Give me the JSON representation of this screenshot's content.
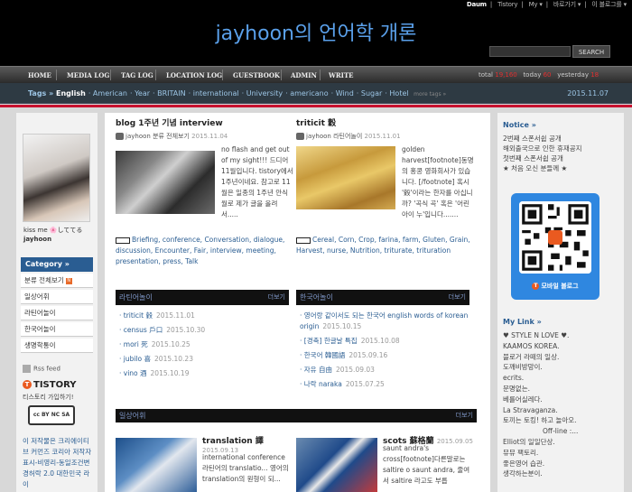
{
  "util": {
    "daum": "Daum",
    "tistory": "Tistory",
    "my": "My ▾",
    "goto": "바로가기 ▾",
    "blog": "이 블로그를 ▾"
  },
  "blog_title": "jayhoon의 언어학 개론",
  "search_button": "SEARCH",
  "nav": [
    "HOME",
    "MEDIA LOG",
    "TAG LOG",
    "LOCATION LOG",
    "GUESTBOOK",
    "ADMIN",
    "WRITE"
  ],
  "stats": {
    "total_label": "total",
    "total": "19,160",
    "today_label": "today",
    "today": "60",
    "yesterday_label": "yesterday",
    "yesterday": "18"
  },
  "tagbar": {
    "label": "Tags » ·",
    "tags": [
      "English",
      "American",
      "Year",
      "BRITAIN",
      "international",
      "University",
      "americano",
      "Wind",
      "Sugar",
      "Hotel"
    ],
    "more": "more tags »",
    "date": "2015.11.07"
  },
  "profile": {
    "caption": "kiss me 🌸しててる",
    "name": "jayhoon"
  },
  "category": {
    "heading": "Category »",
    "items": [
      "분류 전체보기",
      "일상어휘",
      "라틴어놀이",
      "한국어놀이",
      "생명학통이"
    ],
    "new_badge": "N"
  },
  "sidebar_left": {
    "rss": "Rss feed",
    "tistory": "TISTORY",
    "tistory_sub": "티스토리 가입하기!",
    "cc": "cc BY NC SA",
    "license": "이 저작물은 크리에이티브 커먼즈 코리아 저작자표시-비영리-동일조건변경허락 2.0 대한민국 라이"
  },
  "posts": [
    {
      "title": "blog 1주년 기념 interview",
      "author": "jayhoon",
      "category": "분류 전체보기",
      "date": "2015.11.04",
      "text": "no flash and get out of my sight!!! 드디어 11월입니다. tistory에서 1주년이네요. 참고로 11월은 일종의 1주년 안식월로 제가 글을 올려 서.....",
      "tags": "Briefing, conference, Conversation, dialogue, discussion, Encounter, Fair, interview, meeting, presentation, press, Talk"
    },
    {
      "title": "triticit 穀",
      "author": "jayhoon",
      "category": "라틴어놀이",
      "date": "2015.11.01",
      "text": "golden harvest[footnote]동명의 홍콩 영화회사가 있습니다. [/footnote] 혹시 '穀'이라는 한자를 아십니까? '곡식 곡' 혹은 '어린아이 누'입니다.......",
      "tags": "Cereal, Corn, Crop, farina, farm, Gluten, Grain, Harvest, nurse, Nutrition, triturate, trituration"
    }
  ],
  "box_latin": {
    "heading": "라틴어놀이",
    "more": "더보기",
    "items": [
      {
        "t": "triticit 穀",
        "d": "2015.11.01"
      },
      {
        "t": "census 戶口",
        "d": "2015.10.30"
      },
      {
        "t": "mori 死",
        "d": "2015.10.25"
      },
      {
        "t": "jubilo 喜",
        "d": "2015.10.23"
      },
      {
        "t": "vino 酒",
        "d": "2015.10.19"
      }
    ]
  },
  "box_korean": {
    "heading": "한국어놀이",
    "more": "더보기",
    "items": [
      {
        "t": "영어랑 같이서도 되는 한국어 english words of korean origin",
        "d": "2015.10.15"
      },
      {
        "t": "[경축] 한글날 특집",
        "d": "2015.10.08"
      },
      {
        "t": "한국어 韓國語",
        "d": "2015.09.16"
      },
      {
        "t": "자유 自由",
        "d": "2015.09.03"
      },
      {
        "t": "나락 naraka",
        "d": "2015.07.25"
      }
    ]
  },
  "box_daily": {
    "heading": "일상어휘",
    "more": "더보기"
  },
  "posts_bottom": [
    {
      "title": "translation 譯",
      "date": "2015.09.13",
      "text": "international conference 라틴어의 translatio... 영어의 translation의 원형이 되..."
    },
    {
      "title": "scots 蘇格蘭",
      "date": "2015.09.05",
      "text": "saunt andra's cross[footnote]다른말로는 saltire o saunt andra, 줄여서 saltire 라고도 부릅"
    }
  ],
  "notice": {
    "heading": "Notice »",
    "items": [
      "2번째 스폰서쉽 공개",
      "해외출국으로 인한 휴재공지",
      "첫번째 스폰서쉽 공개",
      "★ 처음 오신 분들께 ★"
    ]
  },
  "mobile": {
    "label": "모바일 블로그"
  },
  "mylink": {
    "heading": "My Link »",
    "items": [
      "♥ STYLE N LOVE ♥.",
      "KAAMOS KOREA.",
      "블로거 라떼의 일상.",
      "도깨비방망이.",
      "ecrits.",
      "문명없는.",
      "베를어실레다.",
      "La Stravaganza.",
      "토끼는 토킹! 하고 놀아오.",
      "Off-line :...",
      "Elliot의 일일단상.",
      "뮤뮤 팩토리.",
      "좋은영어 습관.",
      "생각하는분이."
    ]
  },
  "colors": {
    "accent_blue": "#2a5d92",
    "title_blue": "#5aa0ea",
    "red": "#c8102e"
  }
}
